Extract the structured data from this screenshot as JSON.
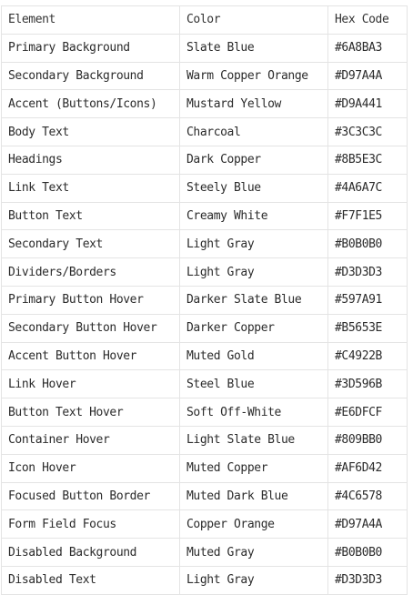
{
  "table": {
    "headers": [
      "Element",
      "Color",
      "Hex Code"
    ],
    "rows": [
      {
        "element": "Primary Background",
        "color": "Slate Blue",
        "hex": "#6A8BA3"
      },
      {
        "element": "Secondary Background",
        "color": "Warm Copper Orange",
        "hex": "#D97A4A"
      },
      {
        "element": "Accent (Buttons/Icons)",
        "color": "Mustard Yellow",
        "hex": "#D9A441"
      },
      {
        "element": "Body Text",
        "color": "Charcoal",
        "hex": "#3C3C3C"
      },
      {
        "element": "Headings",
        "color": "Dark Copper",
        "hex": "#8B5E3C"
      },
      {
        "element": "Link Text",
        "color": "Steely Blue",
        "hex": "#4A6A7C"
      },
      {
        "element": "Button Text",
        "color": "Creamy White",
        "hex": "#F7F1E5"
      },
      {
        "element": "Secondary Text",
        "color": "Light Gray",
        "hex": "#B0B0B0"
      },
      {
        "element": "Dividers/Borders",
        "color": "Light Gray",
        "hex": "#D3D3D3"
      },
      {
        "element": "Primary Button Hover",
        "color": "Darker Slate Blue",
        "hex": "#597A91"
      },
      {
        "element": "Secondary Button Hover",
        "color": "Darker Copper",
        "hex": "#B5653E"
      },
      {
        "element": "Accent Button Hover",
        "color": "Muted Gold",
        "hex": "#C4922B"
      },
      {
        "element": "Link Hover",
        "color": "Steel Blue",
        "hex": "#3D596B"
      },
      {
        "element": "Button Text Hover",
        "color": "Soft Off-White",
        "hex": "#E6DFCF"
      },
      {
        "element": "Container Hover",
        "color": "Light Slate Blue",
        "hex": "#809BB0"
      },
      {
        "element": "Icon Hover",
        "color": "Muted Copper",
        "hex": "#AF6D42"
      },
      {
        "element": "Focused Button Border",
        "color": "Muted Dark Blue",
        "hex": "#4C6578"
      },
      {
        "element": "Form Field Focus",
        "color": "Copper Orange",
        "hex": "#D97A4A"
      },
      {
        "element": "Disabled Background",
        "color": "Muted Gray",
        "hex": "#B0B0B0"
      },
      {
        "element": "Disabled Text",
        "color": "Light Gray",
        "hex": "#D3D3D3"
      }
    ]
  }
}
